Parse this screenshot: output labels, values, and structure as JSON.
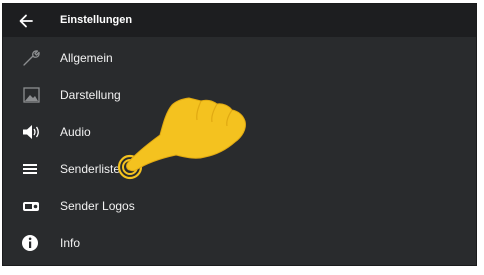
{
  "header": {
    "back_icon": "arrow-left-icon",
    "title": "Einstellungen"
  },
  "menu": {
    "items": [
      {
        "label": "Allgemein",
        "icon": "wrench-icon"
      },
      {
        "label": "Darstellung",
        "icon": "image-icon"
      },
      {
        "label": "Audio",
        "icon": "speaker-icon"
      },
      {
        "label": "Senderliste",
        "icon": "list-icon"
      },
      {
        "label": "Sender Logos",
        "icon": "radio-logo-icon"
      },
      {
        "label": "Info",
        "icon": "info-icon"
      }
    ]
  },
  "overlay": {
    "icon": "pointing-hand-icon",
    "color": "#f4c21f"
  },
  "colors": {
    "background": "#292b2d",
    "header": "#1d1e20",
    "text": "#f2f2f2",
    "icon_gray": "#8c8e90"
  }
}
